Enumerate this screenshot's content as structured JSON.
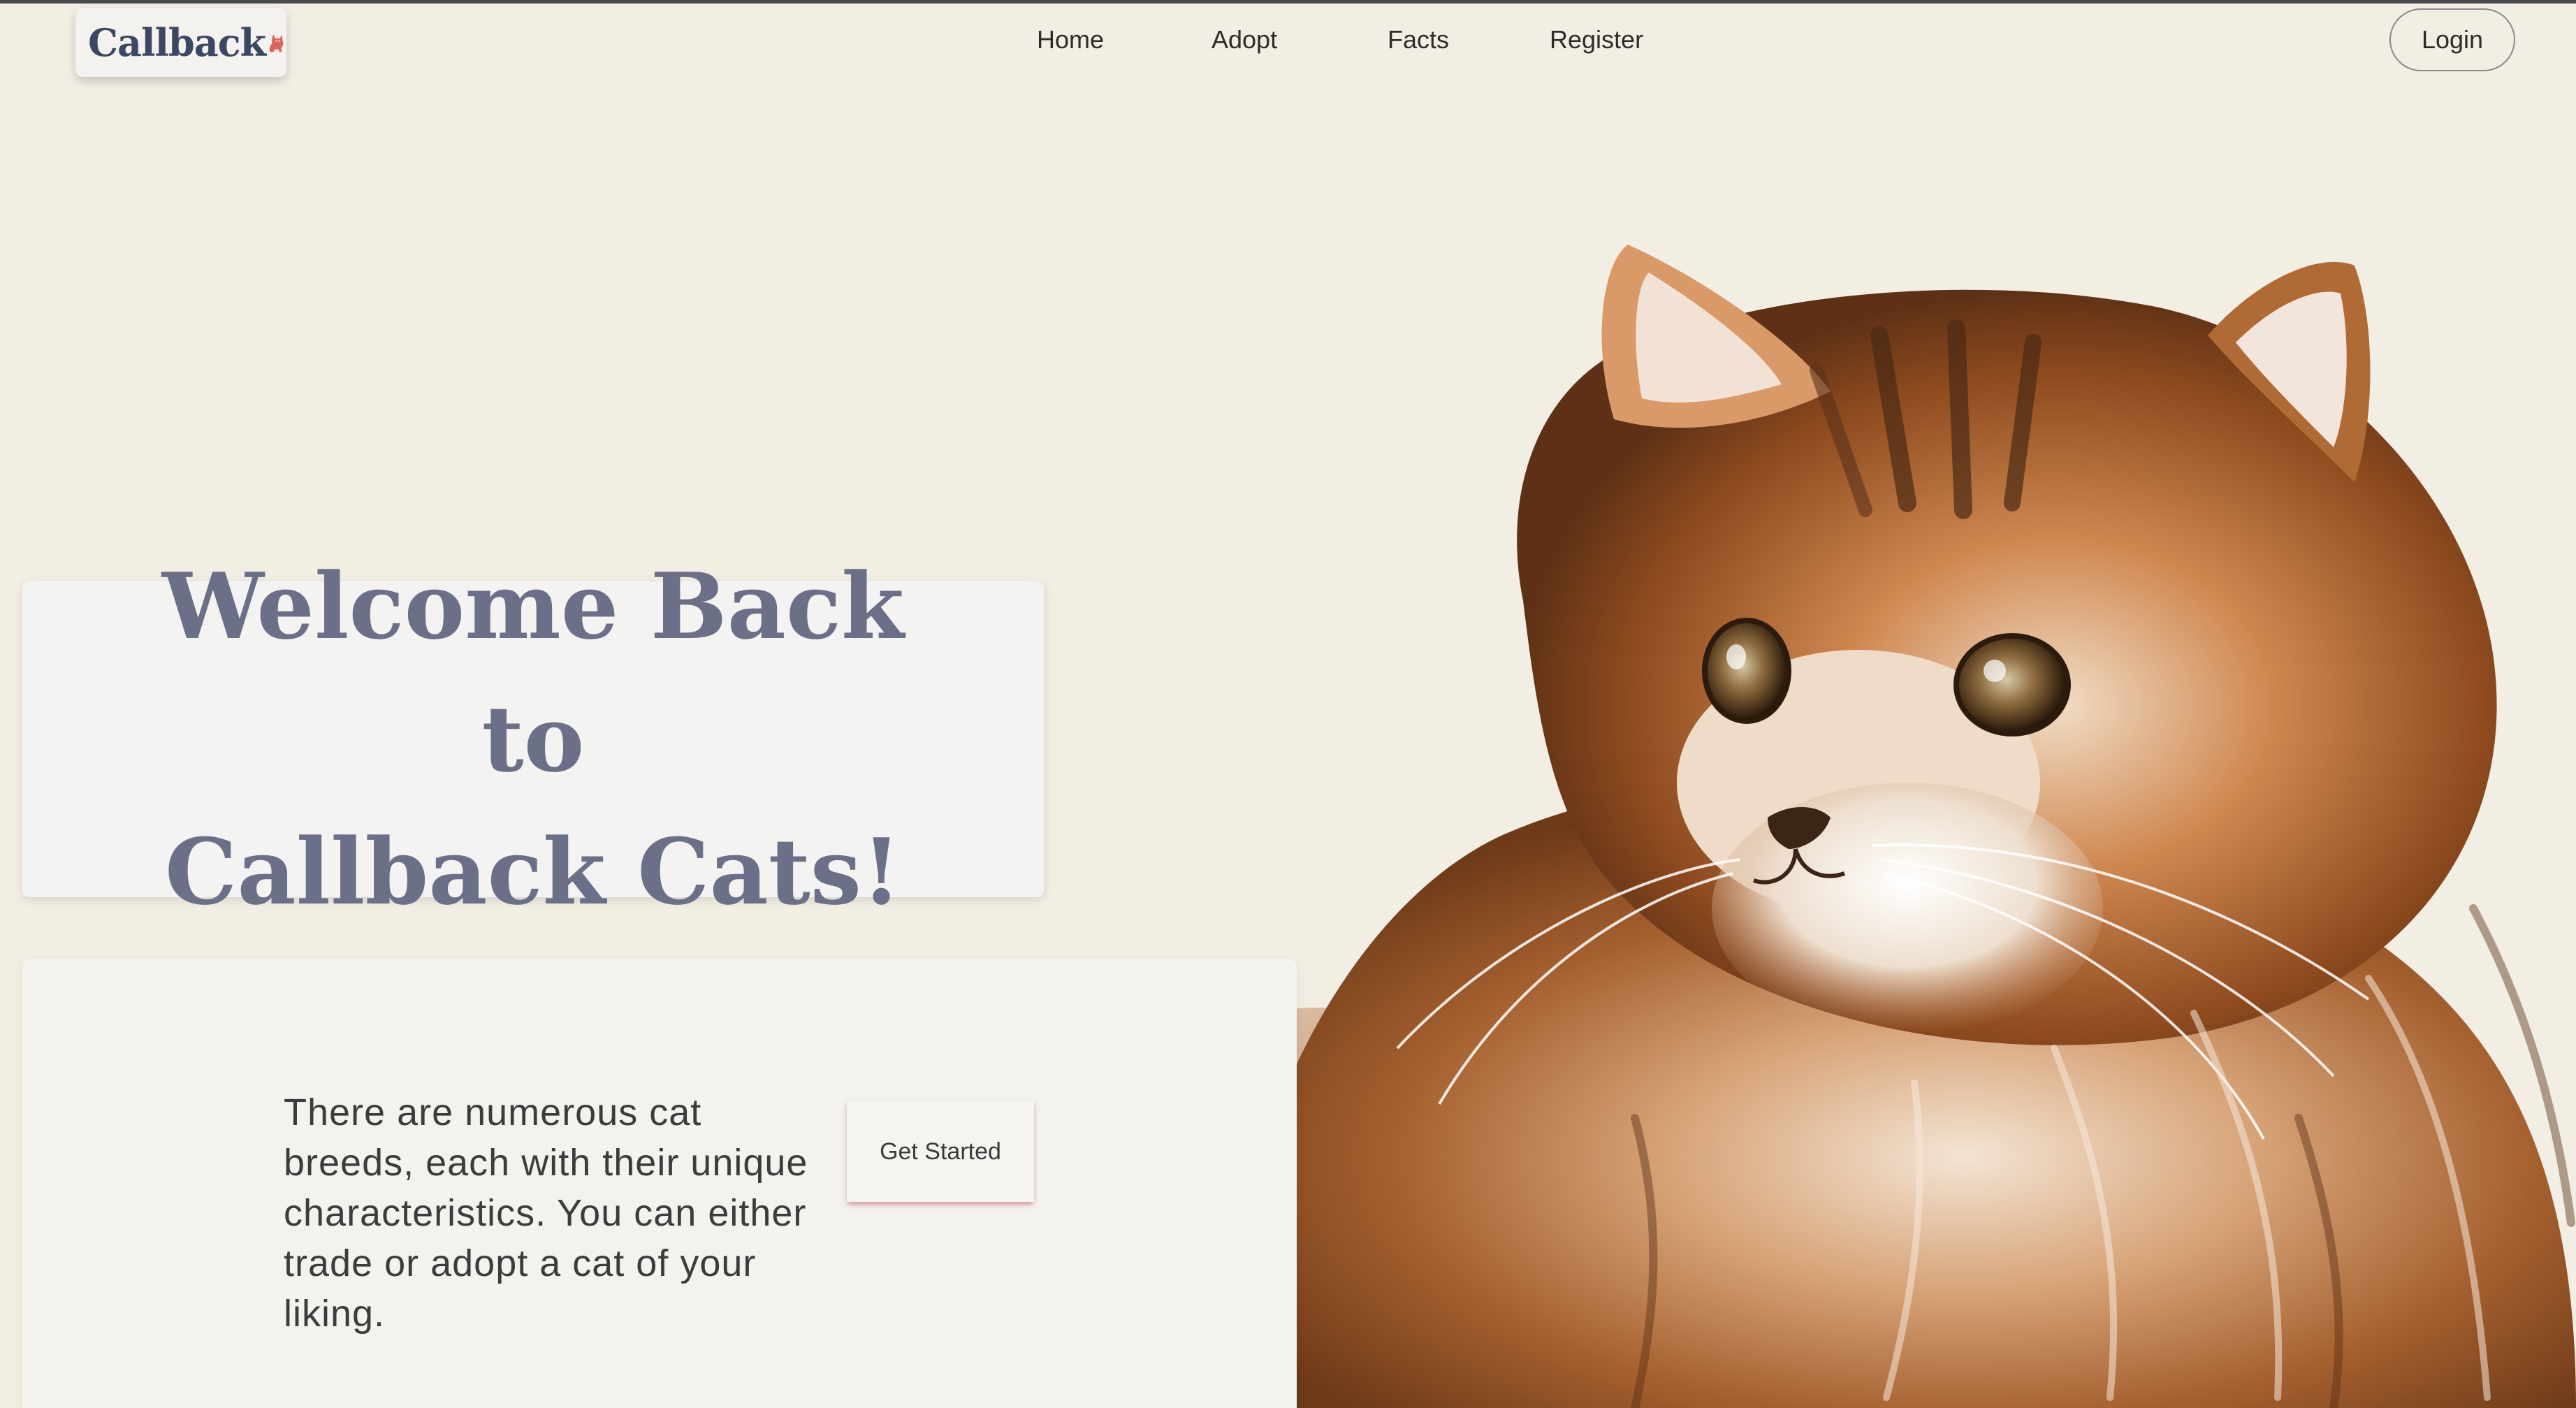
{
  "brand": {
    "name": "Callback",
    "logo_icon": "cat-icon",
    "accent": "#d9665f",
    "text_color": "#3c4763"
  },
  "nav": {
    "items": [
      {
        "label": "Home"
      },
      {
        "label": "Adopt"
      },
      {
        "label": "Facts"
      },
      {
        "label": "Register"
      }
    ],
    "login_label": "Login"
  },
  "hero": {
    "title_line1": "Welcome Back to",
    "title_line2": "Callback Cats!",
    "title_color": "#6b7088",
    "description": "There are numerous cat breeds, each with their unique characteristics. You can either trade or adopt a cat of your liking.",
    "cta_label": "Get Started",
    "image_subject": "fluffy orange tabby cat"
  },
  "colors": {
    "background": "#f2eee4",
    "card": "#f3f3f1"
  }
}
